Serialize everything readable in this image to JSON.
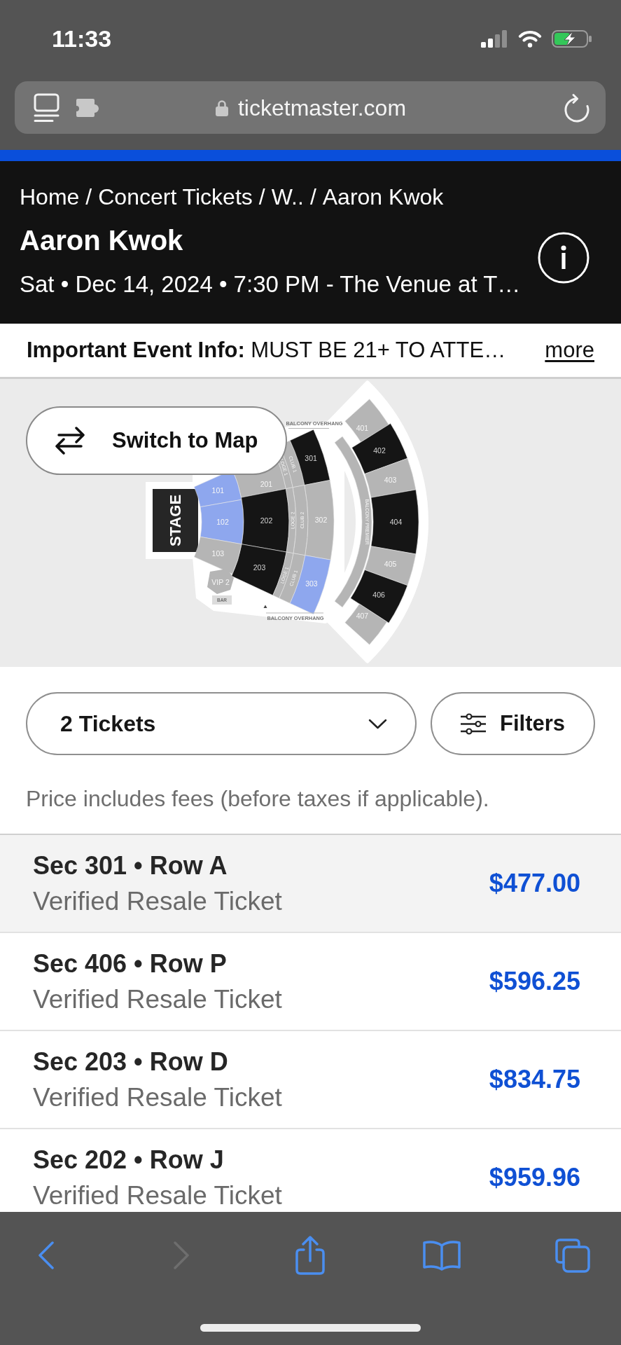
{
  "status_bar": {
    "time": "11:33",
    "battery": {
      "charging": true
    }
  },
  "browser": {
    "url": "ticketmaster.com"
  },
  "header": {
    "breadcrumb": [
      "Home",
      "Concert Tickets",
      "W..",
      "Aaron Kwok"
    ],
    "separator": "/",
    "title": "Aaron Kwok",
    "subtitle": "Sat • Dec 14, 2024 • 7:30 PM - The Venue at T…"
  },
  "notice": {
    "text": "**Important Event Info:** MUST BE 21+ TO ATTE…",
    "link": "more"
  },
  "seat_map": {
    "switch_button": "Switch to Map",
    "stage": "STAGE",
    "sections": [
      {
        "label": "101",
        "color": "#8ea7ee"
      },
      {
        "label": "102",
        "color": "#8ea7ee"
      },
      {
        "label": "103",
        "color": "#b5b5b5"
      },
      {
        "label": "VIP 2",
        "color": "#b5b5b5"
      },
      {
        "label": "BAR",
        "color": "#dcdcdc"
      },
      {
        "label": "201",
        "color": "#b5b5b5"
      },
      {
        "label": "202",
        "color": "#151515"
      },
      {
        "label": "203",
        "color": "#151515"
      },
      {
        "label": "LOGE 1",
        "color": "#b5b5b5"
      },
      {
        "label": "CLUB 1",
        "color": "#b5b5b5"
      },
      {
        "label": "LOGE 2",
        "color": "#b5b5b5"
      },
      {
        "label": "CLUB 2",
        "color": "#b5b5b5"
      },
      {
        "label": "LOGE 1",
        "color": "#b5b5b5"
      },
      {
        "label": "CLUB 1",
        "color": "#b5b5b5"
      },
      {
        "label": "301",
        "color": "#151515"
      },
      {
        "label": "302",
        "color": "#b5b5b5"
      },
      {
        "label": "303",
        "color": "#8ea7ee"
      },
      {
        "label": "BALCONY PREMIER",
        "color": "#b5b5b5"
      },
      {
        "label": "401",
        "color": "#b5b5b5"
      },
      {
        "label": "402",
        "color": "#151515"
      },
      {
        "label": "403",
        "color": "#b5b5b5"
      },
      {
        "label": "404",
        "color": "#151515"
      },
      {
        "label": "405",
        "color": "#b5b5b5"
      },
      {
        "label": "406",
        "color": "#151515"
      },
      {
        "label": "407",
        "color": "#b5b5b5"
      }
    ],
    "notes": [
      {
        "label": "BALCONY OVERHANG"
      },
      {
        "label": "BALCONY OVERHANG"
      }
    ]
  },
  "controls": {
    "quantity": "2 Tickets",
    "filters": "Filters",
    "note": "Price includes fees (before taxes if applicable)."
  },
  "listings": [
    {
      "section": "Sec 301 • Row A",
      "type": "Verified Resale Ticket",
      "price": "$477.00",
      "selected": true
    },
    {
      "section": "Sec 406 • Row P",
      "type": "Verified Resale Ticket",
      "price": "$596.25",
      "selected": false
    },
    {
      "section": "Sec 203 • Row D",
      "type": "Verified Resale Ticket",
      "price": "$834.75",
      "selected": false
    },
    {
      "section": "Sec 202 • Row J",
      "type": "Verified Resale Ticket",
      "price": "$959.96",
      "selected": false
    }
  ],
  "toolbar": [
    {
      "kind": "back",
      "disabled": false
    },
    {
      "kind": "forward",
      "disabled": true
    },
    {
      "kind": "share",
      "disabled": false
    },
    {
      "kind": "bookmarks",
      "disabled": false
    },
    {
      "kind": "tabs",
      "disabled": false
    }
  ]
}
